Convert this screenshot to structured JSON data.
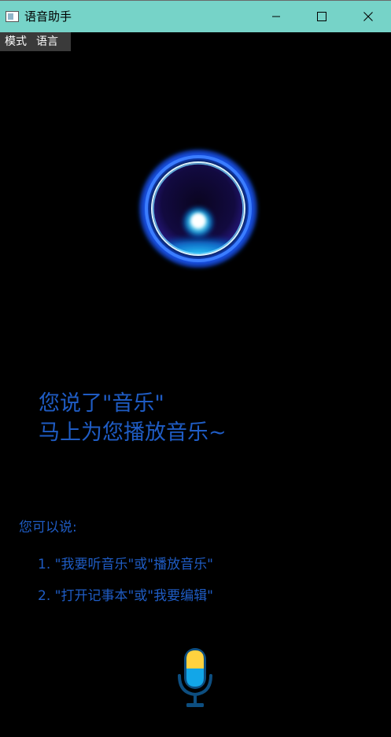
{
  "window": {
    "title": "语音助手",
    "titlebar_color": "#76d3c8"
  },
  "icons": {
    "app": "app-window-icon",
    "minimize": "minimize-icon",
    "maximize": "maximize-icon",
    "close": "close-icon",
    "orb": "voice-orb-icon",
    "mic": "microphone-icon"
  },
  "menu": {
    "items": [
      {
        "label": "模式"
      },
      {
        "label": "语言"
      }
    ]
  },
  "message": {
    "line1": "您说了\"音乐\"",
    "line2": "马上为您播放音乐~",
    "color": "#1f5cc4"
  },
  "hints": {
    "title": "您可以说:",
    "items": [
      {
        "text": "1. \"我要听音乐\"或\"播放音乐\""
      },
      {
        "text": "2. \"打开记事本\"或\"我要编辑\""
      }
    ]
  }
}
